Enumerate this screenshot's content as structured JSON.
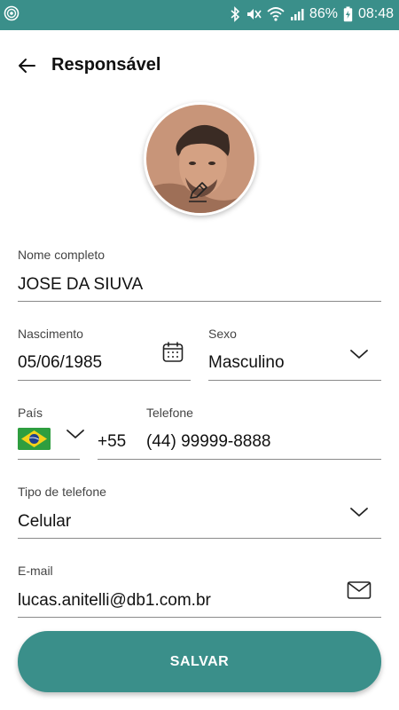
{
  "status_bar": {
    "battery_percent": "86%",
    "time": "08:48",
    "icons": [
      "app-notification-icon",
      "bluetooth-icon",
      "mute-icon",
      "wifi-icon",
      "signal-icon",
      "battery-charging-icon"
    ]
  },
  "header": {
    "title": "Responsável",
    "back_icon": "arrow-left-icon"
  },
  "profile": {
    "edit_icon": "pencil-edit-icon"
  },
  "form": {
    "full_name": {
      "label": "Nome completo",
      "value": "JOSE DA SIUVA"
    },
    "birth_date": {
      "label": "Nascimento",
      "value": "05/06/1985",
      "icon": "calendar-icon"
    },
    "sex": {
      "label": "Sexo",
      "value": "Masculino",
      "icon": "chevron-down-icon"
    },
    "country": {
      "label": "País",
      "flag": "brazil-flag",
      "dial_code": "+55",
      "icon": "chevron-down-icon"
    },
    "phone": {
      "label": "Telefone",
      "value": "(44) 99999-8888"
    },
    "phone_type": {
      "label": "Tipo de telefone",
      "value": "Celular",
      "icon": "chevron-down-icon"
    },
    "email": {
      "label": "E-mail",
      "value": "lucas.anitelli@db1.com.br",
      "icon": "envelope-icon"
    }
  },
  "actions": {
    "save_label": "SALVAR"
  },
  "colors": {
    "primary": "#3a8f8a",
    "text": "#111111",
    "label": "#444444",
    "underline": "#8a8a8a"
  }
}
